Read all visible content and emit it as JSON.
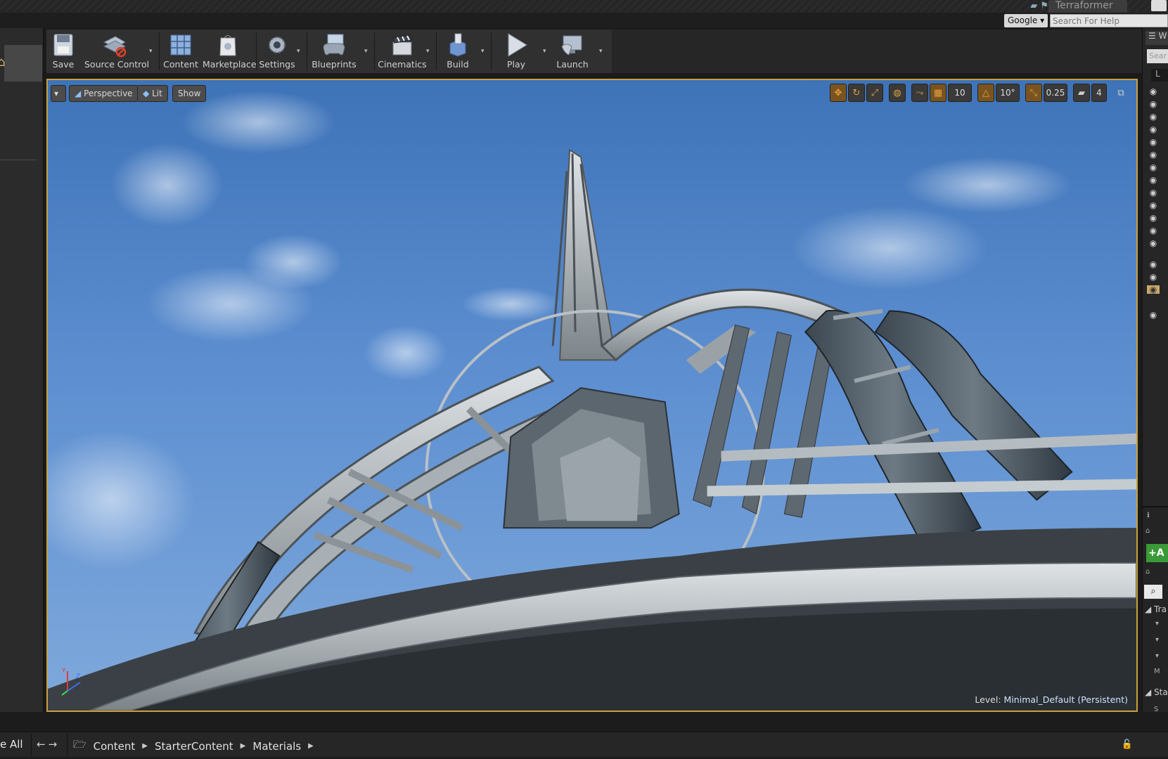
{
  "titlebar": {
    "tab_title": "Terraformer"
  },
  "help": {
    "search_engine": "Google",
    "search_placeholder": "Search For Help"
  },
  "toolbar": {
    "save": "Save",
    "source_control": "Source Control",
    "content": "Content",
    "marketplace": "Marketplace",
    "settings": "Settings",
    "blueprints": "Blueprints",
    "cinematics": "Cinematics",
    "build": "Build",
    "play": "Play",
    "launch": "Launch"
  },
  "viewport": {
    "perspective": "Perspective",
    "lit": "Lit",
    "show": "Show",
    "grid_snap": "10",
    "rotation_snap": "10°",
    "scale_snap": "0.25",
    "camera_speed": "4",
    "level_label": "Level:",
    "level_name": "Minimal_Default (Persistent)"
  },
  "right_panel": {
    "top_label": "W",
    "search_placeholder": "Sear",
    "column_label": "L",
    "add_button": "+A",
    "transform_section": "Tra",
    "static_section": "Sta",
    "mobility_label": "M",
    "s_label": "S"
  },
  "content_browser": {
    "filter_label": "e All",
    "breadcrumbs": [
      "Content",
      "StarterContent",
      "Materials"
    ]
  },
  "colors": {
    "accent": "#c8a040",
    "add_button": "#3b9a37",
    "toolbar_bg": "#303030",
    "sky_top": "#3e73b8"
  }
}
